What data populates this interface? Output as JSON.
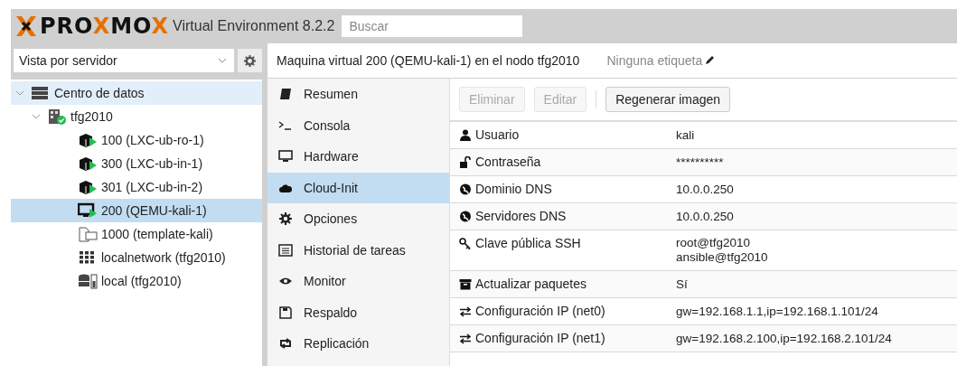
{
  "header": {
    "logo": "PROXMOX",
    "product": "Virtual Environment 8.2.2",
    "search": {
      "placeholder": "Buscar"
    }
  },
  "sidebar": {
    "view_select": "Vista por servidor",
    "tree": [
      {
        "label": "Centro de datos",
        "kind": "datacenter",
        "selected": false,
        "expanded": true,
        "children": [
          {
            "label": "tfg2010",
            "kind": "node",
            "selected": false,
            "expanded": true,
            "children": [
              {
                "label": "100 (LXC-ub-ro-1)",
                "kind": "lxc",
                "selected": false
              },
              {
                "label": "300 (LXC-ub-in-1)",
                "kind": "lxc",
                "selected": false
              },
              {
                "label": "301 (LXC-ub-in-2)",
                "kind": "lxc",
                "selected": false
              },
              {
                "label": "200 (QEMU-kali-1)",
                "kind": "qemu",
                "selected": true
              },
              {
                "label": "1000 (template-kali)",
                "kind": "template",
                "selected": false
              },
              {
                "label": "localnetwork (tfg2010)",
                "kind": "sdn",
                "selected": false
              },
              {
                "label": "local (tfg2010)",
                "kind": "storage",
                "selected": false
              }
            ]
          }
        ]
      }
    ]
  },
  "content": {
    "title": "Maquina virtual 200 (QEMU-kali-1) en el nodo tfg2010",
    "tags": "Ninguna etiqueta",
    "menu": [
      {
        "label": "Resumen",
        "kind": "book",
        "selected": false
      },
      {
        "label": "Consola",
        "kind": "terminal",
        "selected": false
      },
      {
        "label": "Hardware",
        "kind": "desktop",
        "selected": false
      },
      {
        "label": "Cloud-Init",
        "kind": "cloud",
        "selected": true
      },
      {
        "label": "Opciones",
        "kind": "gear",
        "selected": false
      },
      {
        "label": "Historial de tareas",
        "kind": "list",
        "selected": false
      },
      {
        "label": "Monitor",
        "kind": "eye",
        "selected": false
      },
      {
        "label": "Respaldo",
        "kind": "floppy",
        "selected": false
      },
      {
        "label": "Replicación",
        "kind": "retweet",
        "selected": false
      }
    ],
    "toolbar": [
      {
        "label": "Eliminar",
        "disabled": true
      },
      {
        "label": "Editar",
        "disabled": true
      },
      {
        "label": "Regenerar imagen",
        "disabled": false
      }
    ],
    "rows": [
      {
        "label": "Usuario",
        "kind": "user",
        "values": [
          "kali"
        ]
      },
      {
        "label": "Contraseña",
        "kind": "unlock",
        "values": [
          "**********"
        ]
      },
      {
        "label": "Dominio DNS",
        "kind": "globe",
        "values": [
          "10.0.0.250"
        ]
      },
      {
        "label": "Servidores DNS",
        "kind": "globe",
        "values": [
          "10.0.0.250"
        ]
      },
      {
        "label": "Clave pública SSH",
        "kind": "key",
        "values": [
          "root@tfg2010",
          "ansible@tfg2010"
        ]
      },
      {
        "label": "Actualizar paquetes",
        "kind": "archive",
        "values": [
          "Sí"
        ]
      },
      {
        "label": "Configuración IP (net0)",
        "kind": "exchange",
        "values": [
          "gw=192.168.1.1,ip=192.168.1.101/24"
        ]
      },
      {
        "label": "Configuración IP (net1)",
        "kind": "exchange",
        "values": [
          "gw=192.168.2.100,ip=192.168.2.101/24"
        ]
      }
    ]
  }
}
